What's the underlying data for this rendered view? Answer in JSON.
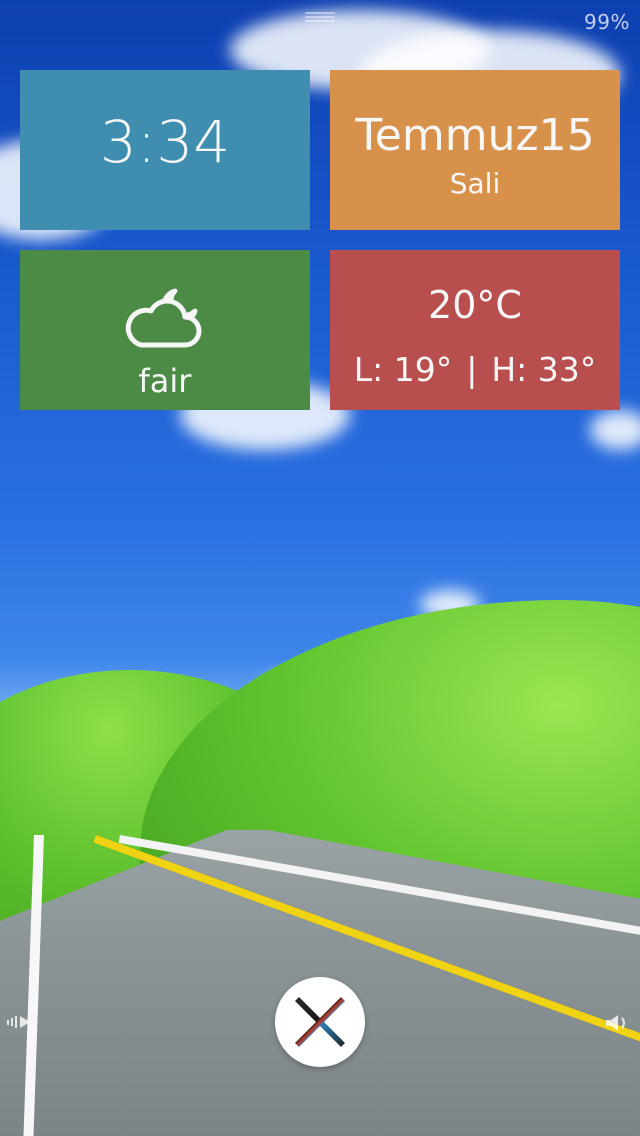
{
  "status": {
    "battery": "99%"
  },
  "tiles": {
    "time": "3:34",
    "date": {
      "month": "Temmuz15",
      "day": "Sali"
    },
    "weather": {
      "icon": "cloud-moon-icon",
      "condition": "fair"
    },
    "temperature": {
      "current": "20°C",
      "low_label": "L: 19°",
      "separator": "|",
      "high_label": "H: 33°"
    }
  },
  "colors": {
    "time_tile": "#3f8eb0",
    "date_tile": "#d7914b",
    "weather_tile": "#4b8b45",
    "temp_tile": "#b84e4e"
  },
  "controls": {
    "center_button_icon": "x-icon",
    "left_icon": "music-icon",
    "right_icon": "volume-icon"
  }
}
